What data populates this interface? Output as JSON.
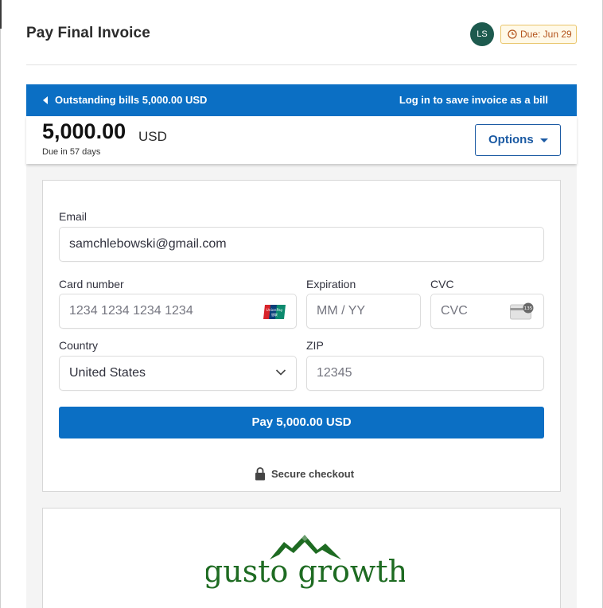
{
  "header": {
    "title": "Pay Final Invoice",
    "avatar_initials": "LS",
    "due_badge": "Due: Jun 29"
  },
  "bluebar": {
    "outstanding": "Outstanding bills 5,000.00 USD",
    "login": "Log in to save invoice as a bill"
  },
  "summary": {
    "amount": "5,000.00",
    "currency": "USD",
    "due_in": "Due in 57 days",
    "options_label": "Options"
  },
  "form": {
    "email_label": "Email",
    "email_value": "samchlebowski@gmail.com",
    "card_label": "Card number",
    "card_placeholder": "1234 1234 1234 1234",
    "expiration_label": "Expiration",
    "expiration_placeholder": "MM / YY",
    "cvc_label": "CVC",
    "cvc_placeholder": "CVC",
    "cvc_icon_text": "135",
    "country_label": "Country",
    "country_value": "United States",
    "zip_label": "ZIP",
    "zip_placeholder": "12345",
    "pay_button": "Pay 5,000.00 USD",
    "secure_text": "Secure checkout"
  },
  "brand": {
    "logo_text": "gusto growth"
  },
  "colors": {
    "primary": "#0b6fc4",
    "avatar": "#1d5a4e",
    "due_badge_border": "#e9c56a",
    "due_badge_text": "#b4541c",
    "logo_green": "#1e6b22"
  }
}
